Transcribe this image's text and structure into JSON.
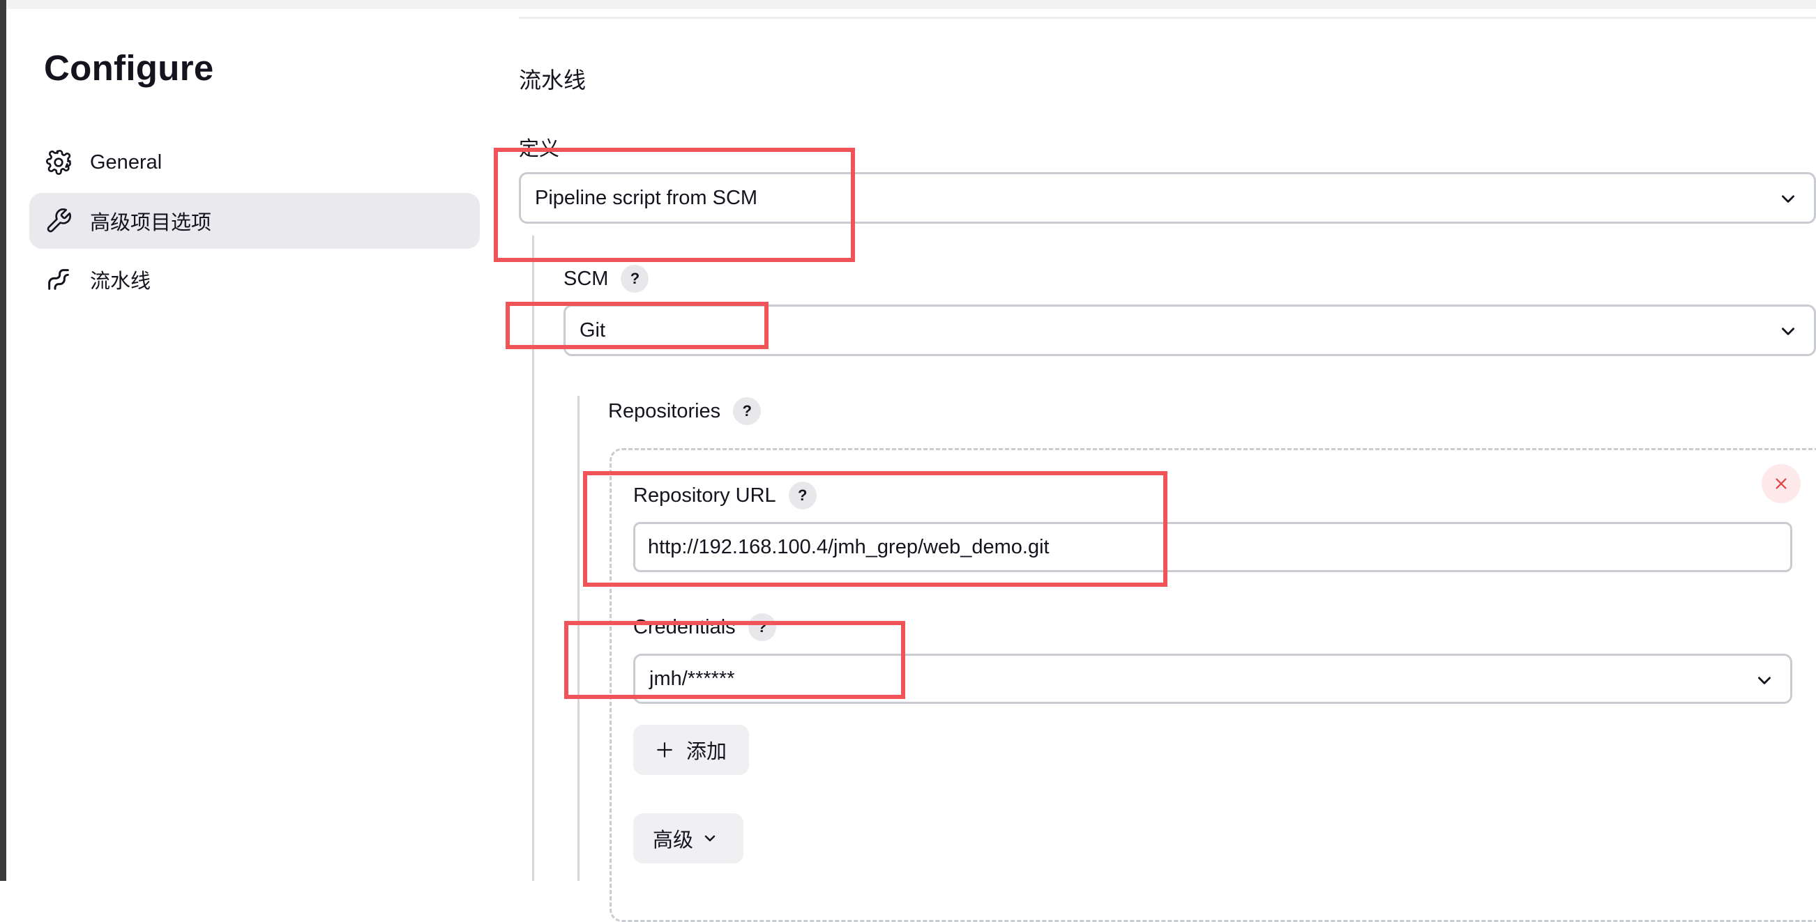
{
  "page": {
    "title": "Configure"
  },
  "sidebar": {
    "items": [
      {
        "label": "General",
        "icon": "gear-icon"
      },
      {
        "label": "高级项目选项",
        "icon": "wrench-icon",
        "active": true
      },
      {
        "label": "流水线",
        "icon": "pipeline-icon"
      }
    ]
  },
  "pipeline": {
    "section_title": "流水线",
    "definition": {
      "label": "定义",
      "value": "Pipeline script from SCM"
    },
    "scm": {
      "label": "SCM",
      "help": "?",
      "value": "Git"
    },
    "repositories": {
      "label": "Repositories",
      "help": "?",
      "repository_url": {
        "label": "Repository URL",
        "help": "?",
        "value": "http://192.168.100.4/jmh_grep/web_demo.git"
      },
      "credentials": {
        "label": "Credentials",
        "help": "?",
        "value": "jmh/******"
      },
      "add_button": {
        "label": "添加",
        "icon": "plus-icon"
      },
      "advanced_button": {
        "label": "高级",
        "icon": "chevron-down-icon"
      },
      "delete_icon": "close-icon"
    }
  },
  "colors": {
    "highlight": "#f05458",
    "active_bg": "#eaeaee",
    "delete_bg": "#fde9ea",
    "delete_fg": "#e0474c"
  }
}
